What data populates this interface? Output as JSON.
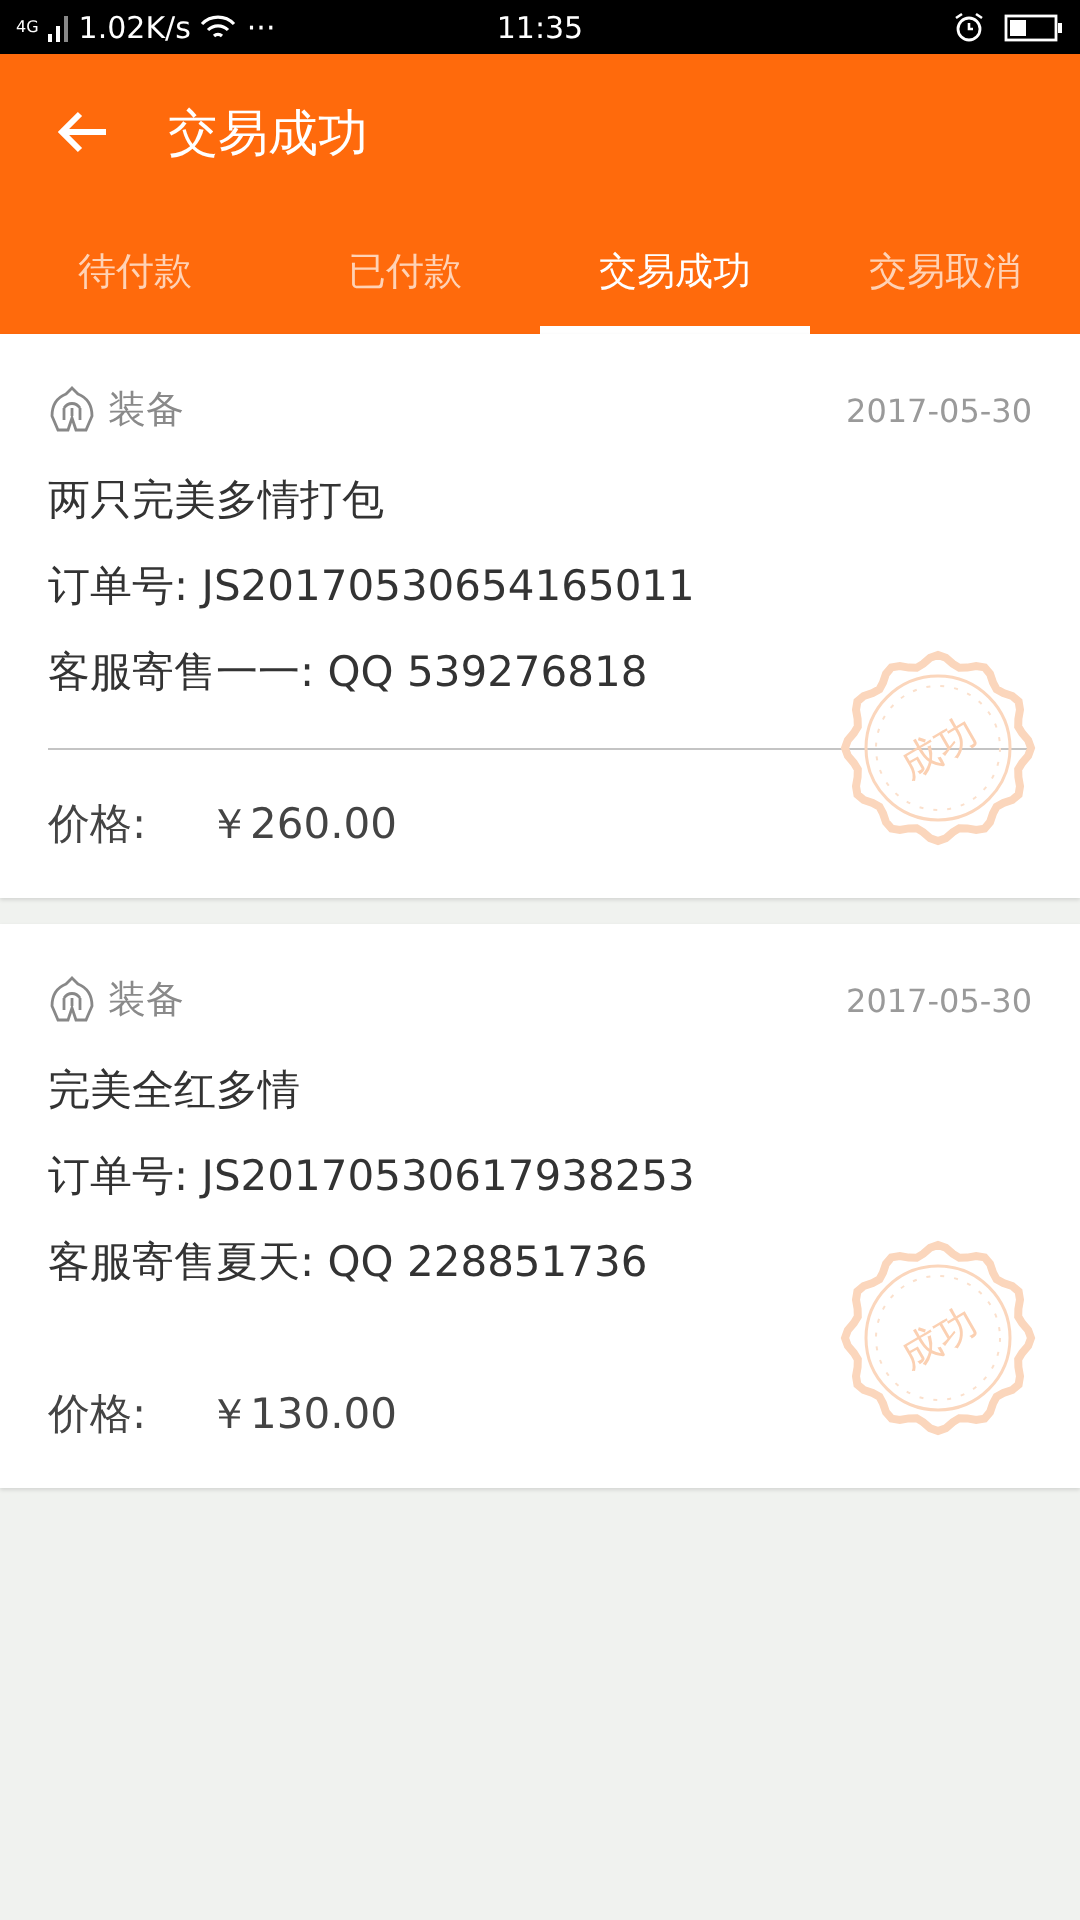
{
  "status_bar": {
    "network": "4G",
    "speed": "1.02K/s",
    "dots": "···",
    "time": "11:35"
  },
  "header": {
    "title": "交易成功"
  },
  "tabs": [
    {
      "label": "待付款",
      "selected": false
    },
    {
      "label": "已付款",
      "selected": false
    },
    {
      "label": "交易成功",
      "selected": true
    },
    {
      "label": "交易取消",
      "selected": false
    }
  ],
  "orders": [
    {
      "category": "装备",
      "date": "2017-05-30",
      "name": "两只完美多情打包",
      "order_no": "订单号: JS20170530654165011",
      "service": "客服寄售一一: QQ 539276818",
      "divider": true,
      "price_label": "价格:",
      "price": "￥260.00",
      "stamp": "成功"
    },
    {
      "category": "装备",
      "date": "2017-05-30",
      "name": "完美全红多情",
      "order_no": "订单号: JS20170530617938253",
      "service": "客服寄售夏天: QQ 228851736",
      "divider": false,
      "price_label": "价格:",
      "price": "￥130.00",
      "stamp": "成功"
    }
  ]
}
